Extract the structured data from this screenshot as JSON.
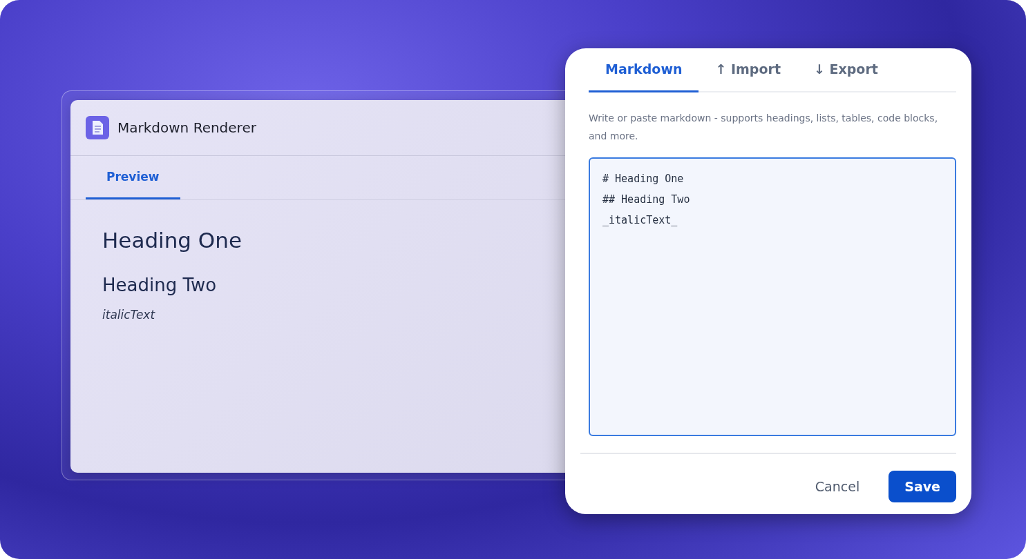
{
  "app_window": {
    "title": "Markdown Renderer",
    "tabs": [
      {
        "label": "Preview",
        "selected": true
      }
    ],
    "preview": [
      {
        "kind": "h1",
        "text": "Heading One"
      },
      {
        "kind": "h2",
        "text": "Heading Two"
      },
      {
        "kind": "em",
        "text": "italicText"
      }
    ]
  },
  "dialog": {
    "tabs": [
      {
        "label": "Markdown",
        "selected": true
      },
      {
        "label": "↑ Import",
        "selected": false
      },
      {
        "label": "↓ Export",
        "selected": false
      }
    ],
    "hint": "Write or paste markdown - supports headings, lists, tables, code blocks, and more.",
    "editor": {
      "value": "# Heading One\n## Heading Two\n_italicText_"
    },
    "buttons": [
      {
        "kind": "secondary",
        "label": "Cancel"
      },
      {
        "kind": "primary",
        "label": "Save"
      }
    ]
  }
}
